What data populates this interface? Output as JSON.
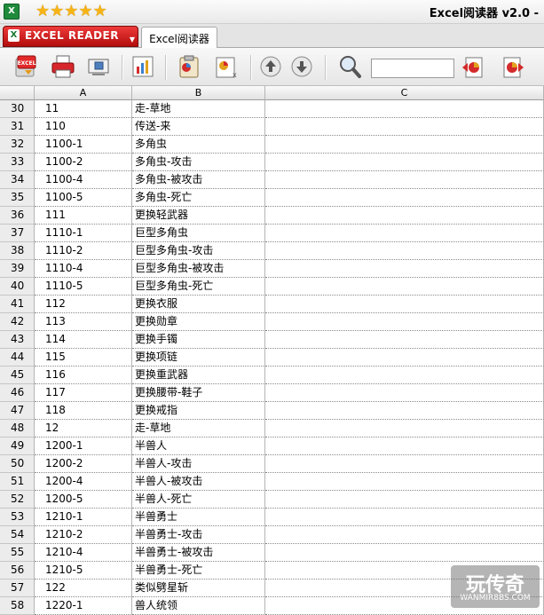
{
  "window": {
    "title": "Excel阅读器 v2.0 -",
    "app_icon": "X",
    "rating_stars": 5
  },
  "tabs": {
    "brand_label": "EXCEL READER",
    "brand_icon": "X",
    "document_tab": "Excel阅读器"
  },
  "toolbar": {
    "buttons": [
      "excel-open-icon",
      "print-icon",
      "screen-icon",
      "chart-icon",
      "clipboard-chart-icon",
      "export-chart-icon",
      "up-arrow-icon",
      "down-arrow-icon",
      "magnifier-icon",
      "prev-chart-icon",
      "next-chart-icon"
    ],
    "search_value": ""
  },
  "colors": {
    "brand_red": "#d41f1f",
    "star": "#f6b416",
    "accent_green": "#1f8a3b"
  },
  "sheet": {
    "columns": [
      "A",
      "B",
      "C"
    ],
    "rows": [
      {
        "n": "30",
        "a": "11",
        "b": "走-草地"
      },
      {
        "n": "31",
        "a": "110",
        "b": "传送-来"
      },
      {
        "n": "32",
        "a": "1100-1",
        "b": "多角虫"
      },
      {
        "n": "33",
        "a": "1100-2",
        "b": "多角虫-攻击"
      },
      {
        "n": "34",
        "a": "1100-4",
        "b": "多角虫-被攻击"
      },
      {
        "n": "35",
        "a": "1100-5",
        "b": "多角虫-死亡"
      },
      {
        "n": "36",
        "a": "111",
        "b": "更换轻武器"
      },
      {
        "n": "37",
        "a": "1110-1",
        "b": "巨型多角虫"
      },
      {
        "n": "38",
        "a": "1110-2",
        "b": "巨型多角虫-攻击"
      },
      {
        "n": "39",
        "a": "1110-4",
        "b": "巨型多角虫-被攻击"
      },
      {
        "n": "40",
        "a": "1110-5",
        "b": "巨型多角虫-死亡"
      },
      {
        "n": "41",
        "a": "112",
        "b": "更换衣服"
      },
      {
        "n": "42",
        "a": "113",
        "b": "更换勋章"
      },
      {
        "n": "43",
        "a": "114",
        "b": "更换手镯"
      },
      {
        "n": "44",
        "a": "115",
        "b": "更换项链"
      },
      {
        "n": "45",
        "a": "116",
        "b": "更换重武器"
      },
      {
        "n": "46",
        "a": "117",
        "b": "更换腰带-鞋子"
      },
      {
        "n": "47",
        "a": "118",
        "b": "更换戒指"
      },
      {
        "n": "48",
        "a": "12",
        "b": "走-草地"
      },
      {
        "n": "49",
        "a": "1200-1",
        "b": "半兽人"
      },
      {
        "n": "50",
        "a": "1200-2",
        "b": "半兽人-攻击"
      },
      {
        "n": "51",
        "a": "1200-4",
        "b": "半兽人-被攻击"
      },
      {
        "n": "52",
        "a": "1200-5",
        "b": "半兽人-死亡"
      },
      {
        "n": "53",
        "a": "1210-1",
        "b": "半兽勇士"
      },
      {
        "n": "54",
        "a": "1210-2",
        "b": "半兽勇士-攻击"
      },
      {
        "n": "55",
        "a": "1210-4",
        "b": "半兽勇士-被攻击"
      },
      {
        "n": "56",
        "a": "1210-5",
        "b": "半兽勇士-死亡"
      },
      {
        "n": "57",
        "a": "122",
        "b": "类似劈星斩"
      },
      {
        "n": "58",
        "a": "1220-1",
        "b": "兽人统领"
      }
    ]
  },
  "watermark": {
    "main": "玩传奇",
    "sub": "WANMIR8BS.COM"
  }
}
